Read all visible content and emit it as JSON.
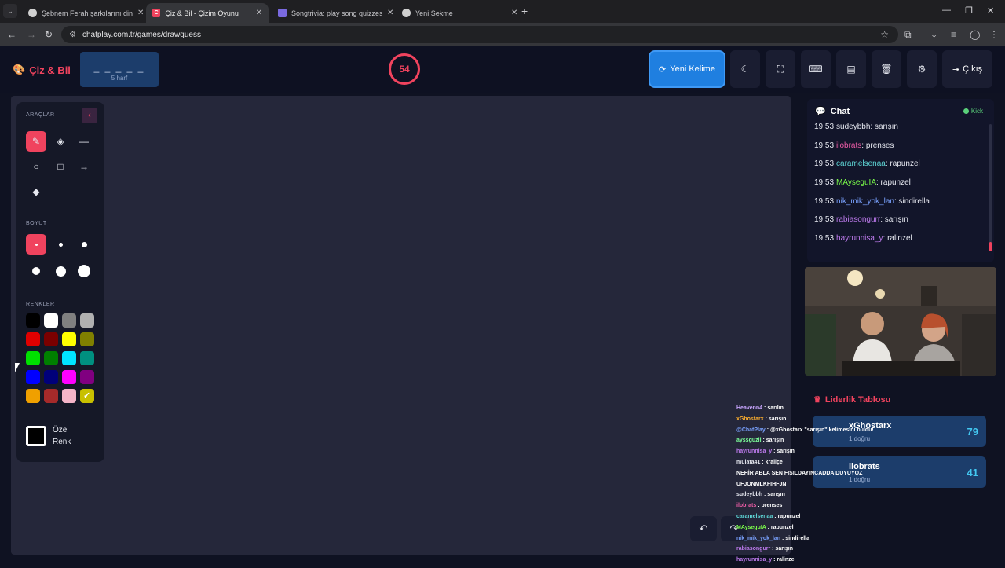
{
  "browser": {
    "tabs": [
      {
        "title": "Şebnem Ferah şarkılarını dinle",
        "active": false
      },
      {
        "title": "Çiz & Bil - Çizim Oyunu",
        "active": true
      },
      {
        "title": "Songtrivia: play song quizzes a",
        "active": false
      },
      {
        "title": "Yeni Sekme",
        "active": false
      }
    ],
    "url": "chatplay.com.tr/games/drawguess"
  },
  "header": {
    "logo": "Çiz & Bil",
    "word_mask": "_ _ _ _ _",
    "word_hint": "5 harf",
    "timer": "54",
    "new_word_label": "Yeni Kelime",
    "exit_label": "Çıkış"
  },
  "tools": {
    "tools_heading": "ARAÇLAR",
    "size_heading": "BOYUT",
    "colors_heading": "RENKLER",
    "custom_color_label_1": "Özel",
    "custom_color_label_2": "Renk",
    "colors": [
      "#000000",
      "#ffffff",
      "#808080",
      "#b0b0b0",
      "#e00000",
      "#7a0000",
      "#ffff00",
      "#808000",
      "#00e000",
      "#008000",
      "#00e5ff",
      "#009080",
      "#0000ff",
      "#00007a",
      "#ff00ff",
      "#800080",
      "#f0a000",
      "#a52a2a",
      "#f4b4c8",
      "#c8c000"
    ]
  },
  "chat": {
    "title": "Chat",
    "status": "Kick",
    "messages": [
      {
        "time": "19:53",
        "user": "sudeyb­bh",
        "color": "#e6e8f0",
        "text": "sarışın"
      },
      {
        "time": "19:53",
        "user": "ilobrats",
        "color": "#ef5da8",
        "text": "prenses"
      },
      {
        "time": "19:53",
        "user": "caramelsenaa",
        "color": "#5fd7d7",
        "text": "rapunzel"
      },
      {
        "time": "19:53",
        "user": "MAyseguIA",
        "color": "#7cff4a",
        "text": "rapunzel"
      },
      {
        "time": "19:53",
        "user": "nik_mik_yok_lan",
        "color": "#7aa2ff",
        "text": "sindirella"
      },
      {
        "time": "19:53",
        "user": "rabiasongurr",
        "color": "#c07cf0",
        "text": "sarışın"
      },
      {
        "time": "19:53",
        "user": "hayrunnisa_y",
        "color": "#c07cf0",
        "text": "ralinzel"
      }
    ]
  },
  "leaderboard": {
    "title": "Liderlik Tablosu",
    "rows": [
      {
        "name": "xGhostarx",
        "sub": "1 doğru",
        "points": "79"
      },
      {
        "name": "ilobrats",
        "sub": "1 doğru",
        "points": "41"
      }
    ]
  },
  "overlay": {
    "lines": [
      {
        "user": "Heavenn4",
        "color": "#c9a6ff",
        "text": "sarılın"
      },
      {
        "user": "xGhostarx",
        "color": "#ffb02e",
        "text": "sarışın"
      },
      {
        "user": "@ChatPlay",
        "color": "#7aa2ff",
        "text": "@xGhostarx \"sarışın\" kelimesini buldu!"
      },
      {
        "user": "ayssguzll",
        "color": "#7cff9a",
        "text": "sarışın"
      },
      {
        "user": "hayrunnisa_y",
        "color": "#c07cf0",
        "text": "sarışın"
      },
      {
        "user": "mulata41",
        "color": "#e6e8f0",
        "text": "kraliçe"
      },
      {
        "user": "",
        "color": "#e6e8f0",
        "text": "NEHİR ABLA SEN FISILDAYINCADDA DUYUYOZ"
      },
      {
        "user": "",
        "color": "#e6e8f0",
        "text": "UFJONMLKFIHFJN"
      },
      {
        "user": "sudeybbh",
        "color": "#e6e8f0",
        "text": "sarışın"
      },
      {
        "user": "ilobrats",
        "color": "#ef5da8",
        "text": "prenses"
      },
      {
        "user": "caramelsenaa",
        "color": "#5fd7d7",
        "text": "rapunzel"
      },
      {
        "user": "MAyseguIA",
        "color": "#7cff4a",
        "text": "rapunzel"
      },
      {
        "user": "nik_mik_yok_lan",
        "color": "#7aa2ff",
        "text": "sindirella"
      },
      {
        "user": "rabiasongurr",
        "color": "#c07cf0",
        "text": "sarışın"
      },
      {
        "user": "hayrunnisa_y",
        "color": "#c07cf0",
        "text": "ralinzel"
      }
    ]
  }
}
